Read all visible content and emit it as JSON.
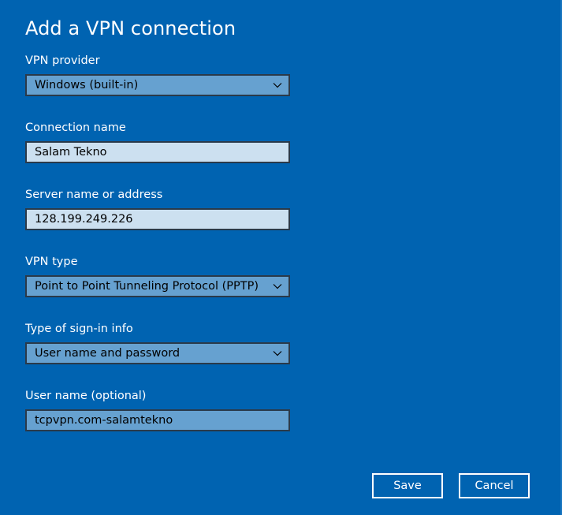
{
  "dialog": {
    "title": "Add a VPN connection"
  },
  "fields": {
    "vpn_provider": {
      "label": "VPN provider",
      "value": "Windows (built-in)"
    },
    "connection_name": {
      "label": "Connection name",
      "value": "Salam Tekno"
    },
    "server_address": {
      "label": "Server name or address",
      "value": "128.199.249.226"
    },
    "vpn_type": {
      "label": "VPN type",
      "value": "Point to Point Tunneling Protocol (PPTP)"
    },
    "signin_type": {
      "label": "Type of sign-in info",
      "value": "User name and password"
    },
    "username": {
      "label": "User name (optional)",
      "value": "tcpvpn.com-salamtekno"
    }
  },
  "buttons": {
    "save": "Save",
    "cancel": "Cancel"
  },
  "icons": {
    "dropdown": "chevron-down-icon"
  },
  "colors": {
    "background": "#0063b1",
    "select_fill": "#66a1d0",
    "input_fill_focused": "#cce0f0",
    "border": "#2a3a4a"
  }
}
